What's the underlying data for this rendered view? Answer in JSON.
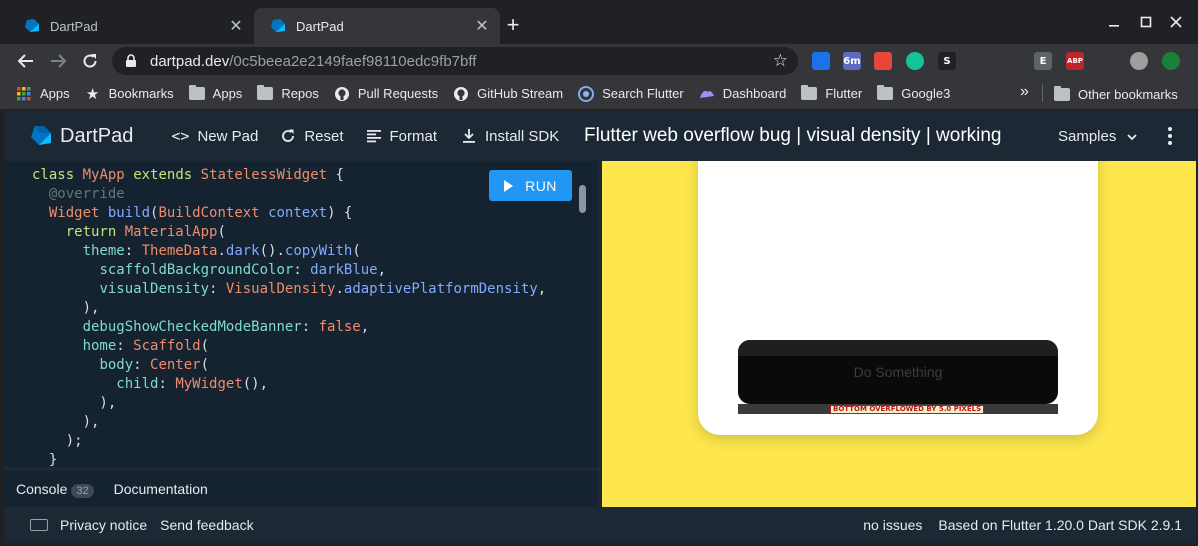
{
  "browser": {
    "tabs": [
      {
        "title": "DartPad",
        "active": false
      },
      {
        "title": "DartPad",
        "active": true
      }
    ],
    "new_tab_symbol": "+",
    "url": {
      "host": "dartpad.dev",
      "path": "/0c5beea2e2149faef98110edc9fb7bff"
    },
    "extensions": [
      {
        "icon": "checkmark-extension-icon",
        "color": "#1a73e8",
        "text": ""
      },
      {
        "icon": "timer-extension-icon",
        "color": "#5c6bc0",
        "text": "6m"
      },
      {
        "icon": "camera-extension-icon",
        "color": "#e8453c",
        "text": ""
      },
      {
        "icon": "grammarly-extension-icon",
        "color": "#15c39a",
        "text": ""
      },
      {
        "icon": "s-extension-icon",
        "color": "#202124",
        "text": "S"
      },
      {
        "icon": "bulb-extension-icon",
        "color": "#35363a",
        "text": ""
      },
      {
        "icon": "ghost-extension-icon",
        "color": "#35363a",
        "text": ""
      },
      {
        "icon": "e-extension-icon",
        "color": "#5f6368",
        "text": "E"
      },
      {
        "icon": "adblock-extension-icon",
        "color": "#c0242b",
        "text": "ABP"
      },
      {
        "icon": "puzzle-extensions-icon",
        "color": "#35363a",
        "text": ""
      },
      {
        "icon": "profile-avatar-icon",
        "color": "#9e9e9e",
        "text": ""
      },
      {
        "icon": "update-arrow-icon",
        "color": "#188038",
        "text": ""
      }
    ],
    "bookmarks": [
      {
        "label": "Apps",
        "icon": "apps-grid-icon"
      },
      {
        "label": "Bookmarks",
        "icon": "star-icon"
      },
      {
        "label": "Apps",
        "icon": "folder-icon"
      },
      {
        "label": "Repos",
        "icon": "folder-icon"
      },
      {
        "label": "Pull Requests",
        "icon": "github-icon"
      },
      {
        "label": "GitHub Stream",
        "icon": "github-icon"
      },
      {
        "label": "Search Flutter",
        "icon": "search-flutter-icon"
      },
      {
        "label": "Dashboard",
        "icon": "dashboard-icon"
      },
      {
        "label": "Flutter",
        "icon": "folder-icon"
      },
      {
        "label": "Google3",
        "icon": "folder-icon"
      }
    ],
    "overflow_symbol": "»",
    "other_bookmarks": "Other bookmarks"
  },
  "dartpad": {
    "logo_text": "DartPad",
    "new_pad": "New Pad",
    "reset": "Reset",
    "format": "Format",
    "install_sdk": "Install SDK",
    "title": "Flutter web overflow bug | visual density | working",
    "samples": "Samples",
    "run": "RUN",
    "console_tab": "Console",
    "console_count": "32",
    "documentation_tab": "Documentation",
    "privacy": "Privacy notice",
    "feedback": "Send feedback",
    "issues": "no issues",
    "sdk_info": "Based on Flutter 1.20.0 Dart SDK 2.9.1"
  },
  "code_lines": [
    "class MyApp extends StatelessWidget {",
    "  @override",
    "  Widget build(BuildContext context) {",
    "    return MaterialApp(",
    "      theme: ThemeData.dark().copyWith(",
    "        scaffoldBackgroundColor: darkBlue,",
    "        visualDensity: VisualDensity.adaptivePlatformDensity,",
    "      ),",
    "      debugShowCheckedModeBanner: false,",
    "      home: Scaffold(",
    "        body: Center(",
    "          child: MyWidget(),",
    "        ),",
    "      ),",
    "    );",
    "  }"
  ],
  "preview": {
    "button_label": "Do Something",
    "overflow_message": "BOTTOM OVERFLOWED BY 5.0 PIXELS",
    "background_color": "#fde74c"
  },
  "colors": {
    "accent": "#2196f3",
    "header_bg": "#1c2834",
    "editor_bg": "#14232f"
  }
}
